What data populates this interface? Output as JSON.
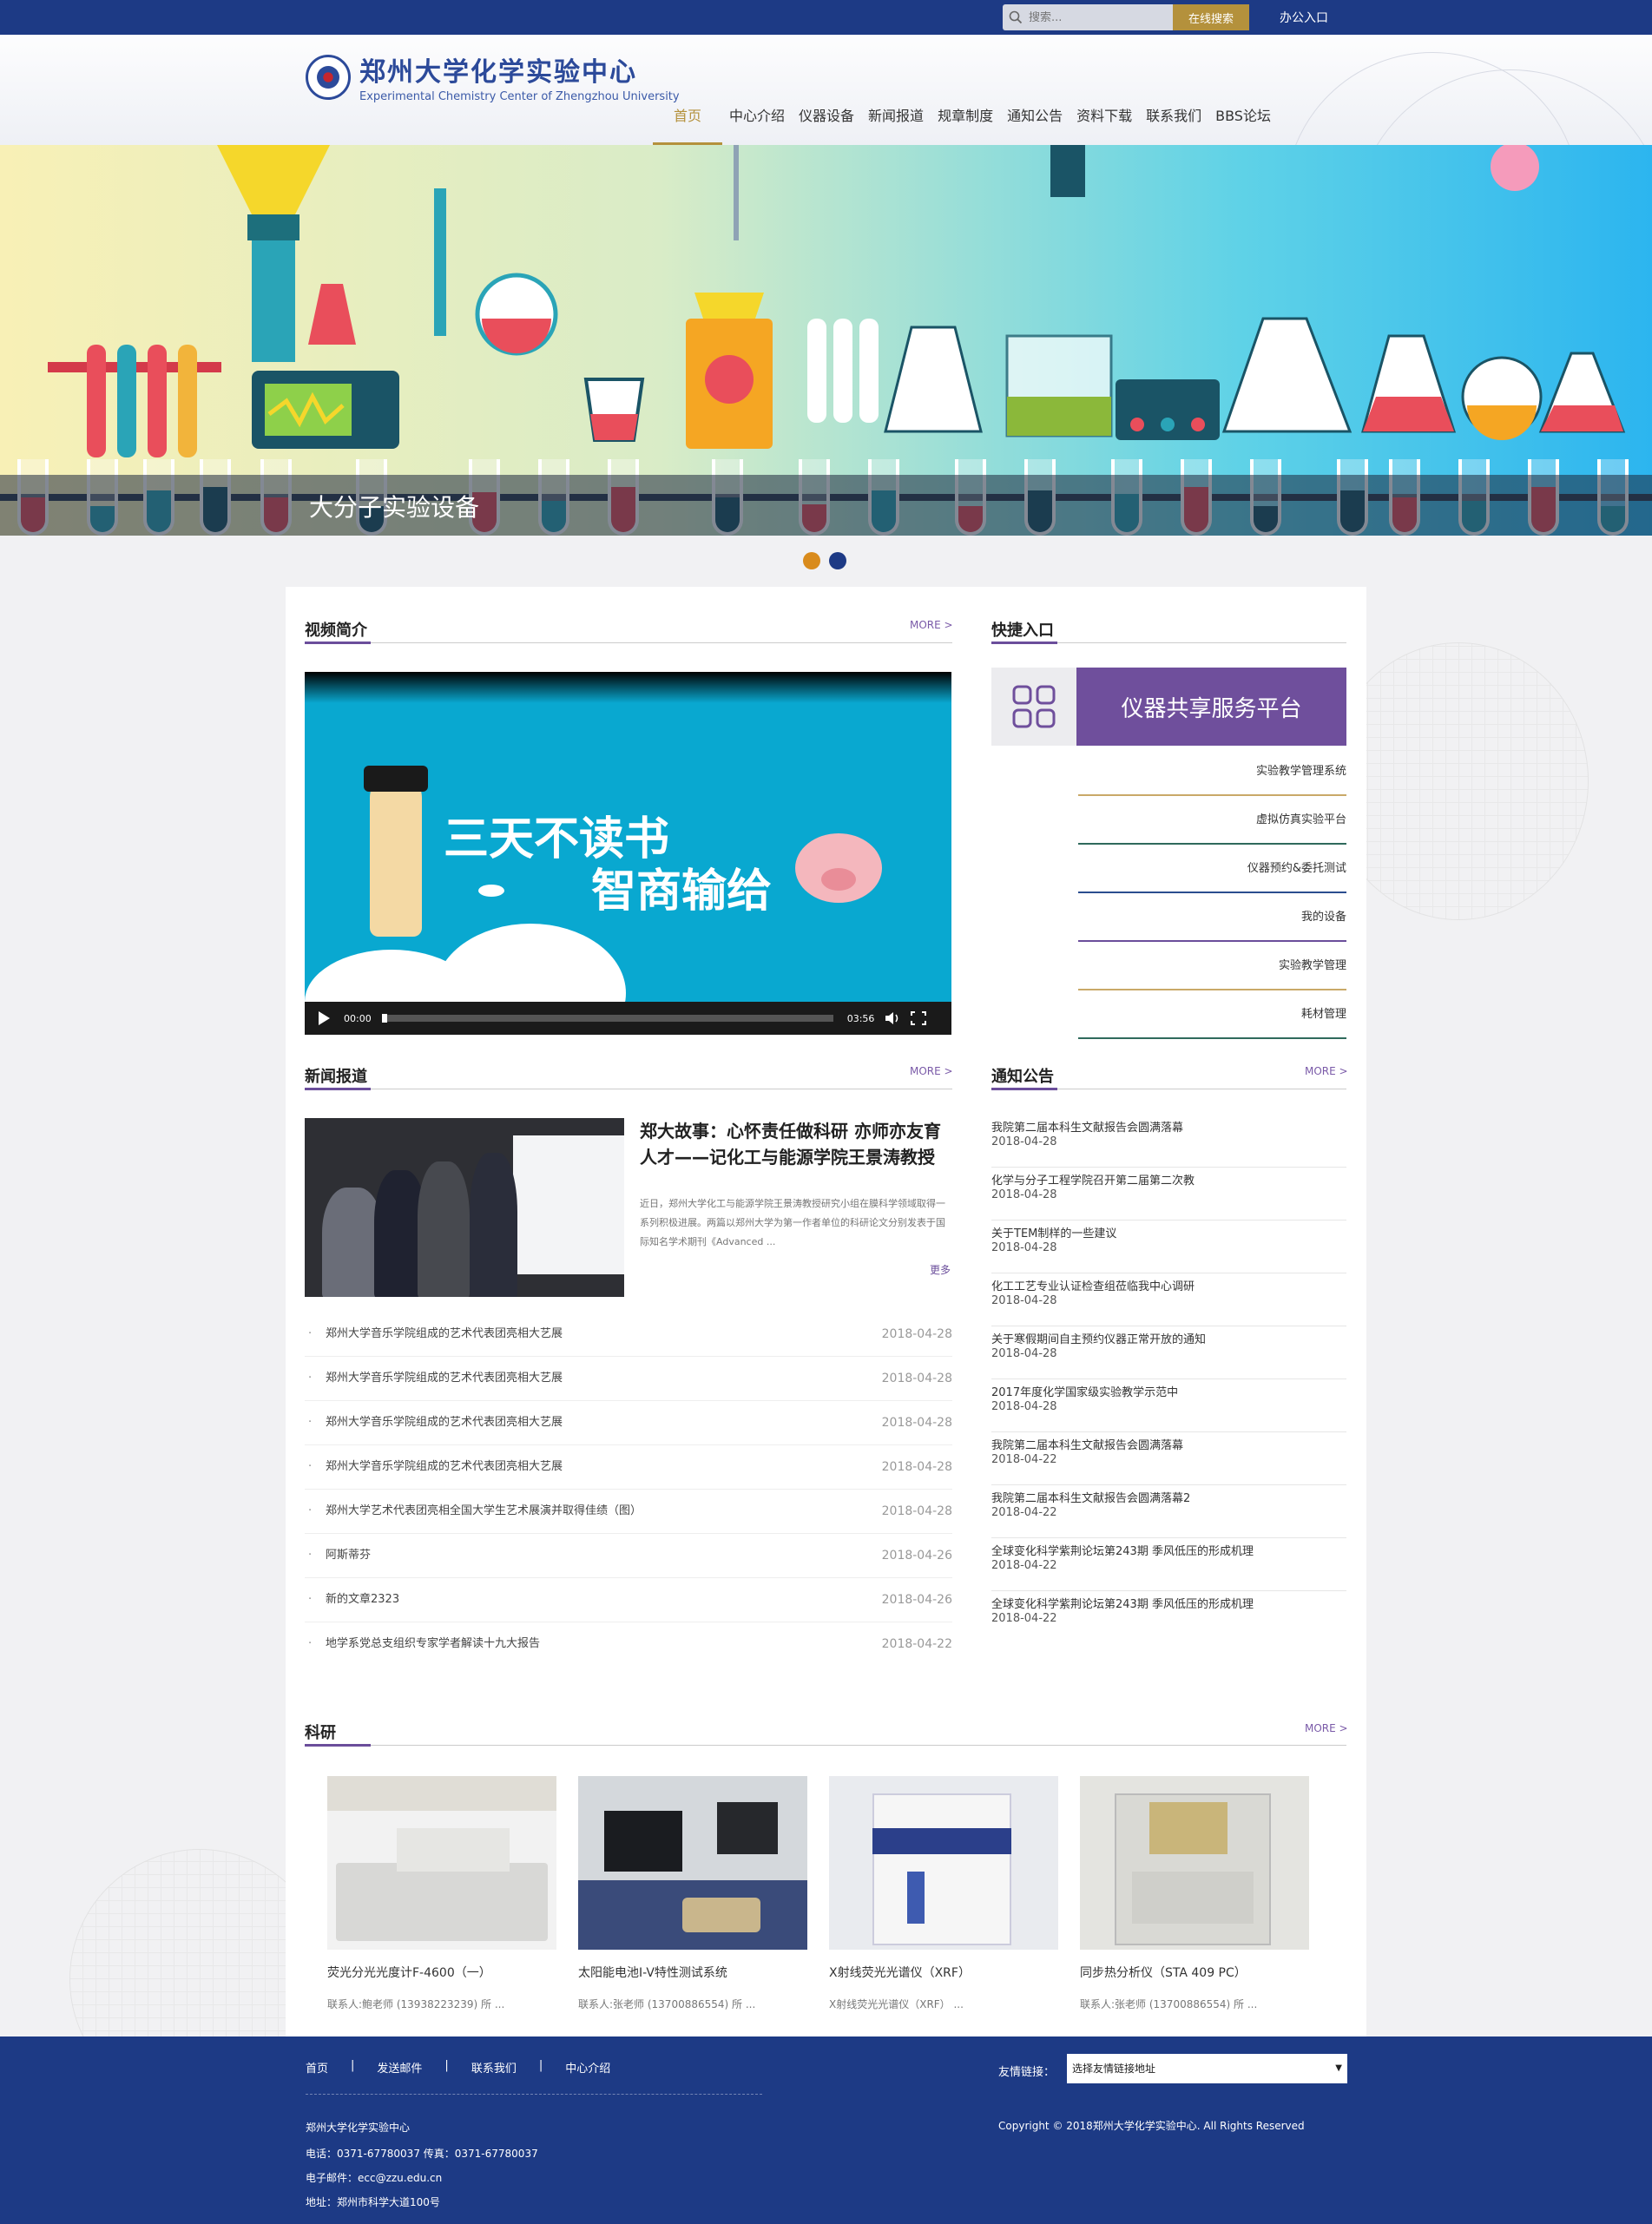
{
  "topbar": {
    "search_placeholder": "搜索...",
    "search_button": "在线搜索",
    "office_link": "办公入口"
  },
  "header": {
    "logo_cn": "郑州大学化学实验中心",
    "logo_en": "Experimental Chemistry Center of Zhengzhou University",
    "nav": [
      "首页",
      "中心介绍",
      "仪器设备",
      "新闻报道",
      "规章制度",
      "通知公告",
      "资料下载",
      "联系我们",
      "BBS论坛"
    ],
    "active_nav": "首页"
  },
  "banner": {
    "caption": "大分子实验设备",
    "dot_colors": [
      "#d98b1c",
      "#1d3a85"
    ]
  },
  "video": {
    "title": "视频简介",
    "more": "MORE >",
    "text_line1": "三天不读书",
    "text_line2": "智商输给",
    "current_time": "00:00",
    "duration": "03:56"
  },
  "quick": {
    "title": "快捷入口",
    "banner_label": "仪器共享服务平台",
    "items": [
      {
        "label": "实验教学管理系统",
        "color": "#c9a968"
      },
      {
        "label": "虚拟仿真实验平台",
        "color": "#2f6a5c"
      },
      {
        "label": "仪器预约&委托测试",
        "color": "#2b4d8f"
      },
      {
        "label": "我的设备",
        "color": "#6b4e9b"
      },
      {
        "label": "实验教学管理",
        "color": "#c9a968"
      },
      {
        "label": "耗材管理",
        "color": "#2f6a5c"
      }
    ]
  },
  "news": {
    "title": "新闻报道",
    "more": "MORE >",
    "feature_title": "郑大故事：心怀责任做科研 亦师亦友育人才——记化工与能源学院王景涛教授",
    "feature_desc": "近日，郑州大学化工与能源学院王景涛教授研究小组在膜科学领域取得一系列积极进展。两篇以郑州大学为第一作者单位的科研论文分别发表于国际知名学术期刊《Advanced ...",
    "feature_more": "更多",
    "items": [
      {
        "title": "郑州大学音乐学院组成的艺术代表团亮相大艺展",
        "date": "2018-04-28"
      },
      {
        "title": "郑州大学音乐学院组成的艺术代表团亮相大艺展",
        "date": "2018-04-28"
      },
      {
        "title": "郑州大学音乐学院组成的艺术代表团亮相大艺展",
        "date": "2018-04-28"
      },
      {
        "title": "郑州大学音乐学院组成的艺术代表团亮相大艺展",
        "date": "2018-04-28"
      },
      {
        "title": "郑州大学艺术代表团亮相全国大学生艺术展演并取得佳绩（图）",
        "date": "2018-04-28"
      },
      {
        "title": "阿斯蒂芬",
        "date": "2018-04-26"
      },
      {
        "title": "新的文章2323",
        "date": "2018-04-26"
      },
      {
        "title": "地学系党总支组织专家学者解读十九大报告",
        "date": "2018-04-22"
      }
    ]
  },
  "notice": {
    "title": "通知公告",
    "more": "MORE >",
    "items": [
      {
        "title": "我院第二届本科生文献报告会圆满落幕",
        "date": "2018-04-28"
      },
      {
        "title": "化学与分子工程学院召开第二届第二次教",
        "date": "2018-04-28"
      },
      {
        "title": "关于TEM制样的一些建议",
        "date": "2018-04-28"
      },
      {
        "title": "化工工艺专业认证检查组莅临我中心调研",
        "date": "2018-04-28"
      },
      {
        "title": "关于寒假期间自主预约仪器正常开放的通知",
        "date": "2018-04-28"
      },
      {
        "title": "2017年度化学国家级实验教学示范中",
        "date": "2018-04-28"
      },
      {
        "title": "我院第二届本科生文献报告会圆满落幕",
        "date": "2018-04-22"
      },
      {
        "title": "我院第二届本科生文献报告会圆满落幕2",
        "date": "2018-04-22"
      },
      {
        "title": "全球变化科学紫荆论坛第243期 季风低压的形成机理",
        "date": "2018-04-22"
      },
      {
        "title": "全球变化科学紫荆论坛第243期 季风低压的形成机理",
        "date": "2018-04-22"
      }
    ]
  },
  "research": {
    "title": "科研",
    "more": "MORE >",
    "items": [
      {
        "title": "荧光分光光度计F-4600（一）",
        "desc": "联系人:鲍老师 (13938223239) 所 ..."
      },
      {
        "title": "太阳能电池I-V特性测试系统",
        "desc": "联系人:张老师 (13700886554) 所 ..."
      },
      {
        "title": "X射线荧光光谱仪（XRF）",
        "desc": "X射线荧光光谱仪（XRF） ..."
      },
      {
        "title": "同步热分析仪（STA 409 PC）",
        "desc": "联系人:张老师 (13700886554) 所 ..."
      }
    ]
  },
  "footer": {
    "links": [
      "首页",
      "发送邮件",
      "联系我们",
      "中心介绍"
    ],
    "separator": "|",
    "org": "郑州大学化学实验中心",
    "phone": "电话：0371-67780037 传真：0371-67780037",
    "email": "电子邮件：ecc@zzu.edu.cn",
    "address": "地址：郑州市科学大道100号",
    "friend_label": "友情链接：",
    "friend_select": "选择友情链接地址",
    "copyright": "Copyright © 2018郑州大学化学实验中心. All Rights Reserved"
  }
}
